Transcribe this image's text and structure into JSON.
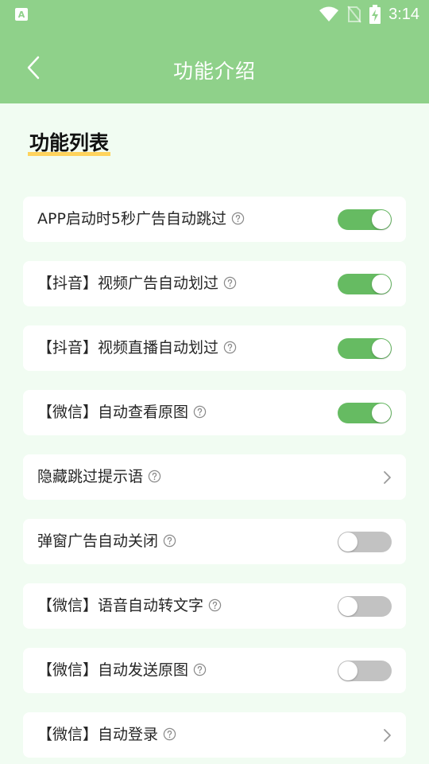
{
  "status_bar": {
    "app_icon_glyph": "A",
    "time": "3:14",
    "icons": [
      "wifi-icon",
      "no-sim-icon",
      "battery-charging-icon"
    ]
  },
  "header": {
    "title": "功能介绍",
    "back_icon": "chevron-left-icon",
    "background_color": "#8fd18a"
  },
  "section": {
    "title": "功能列表",
    "underline_color": "#ffd35c"
  },
  "colors": {
    "page_background": "#f1fcf2",
    "toggle_on": "#66bb62",
    "toggle_off": "#c2c2c2"
  },
  "features": [
    {
      "label": "APP启动时5秒广告自动跳过",
      "control": "toggle",
      "state": "on"
    },
    {
      "label": "【抖音】视频广告自动划过",
      "control": "toggle",
      "state": "on"
    },
    {
      "label": "【抖音】视频直播自动划过",
      "control": "toggle",
      "state": "on"
    },
    {
      "label": "【微信】自动查看原图",
      "control": "toggle",
      "state": "on"
    },
    {
      "label": "隐藏跳过提示语",
      "control": "chevron",
      "state": ""
    },
    {
      "label": "弹窗广告自动关闭",
      "control": "toggle",
      "state": "off"
    },
    {
      "label": "【微信】语音自动转文字",
      "control": "toggle",
      "state": "off"
    },
    {
      "label": "【微信】自动发送原图",
      "control": "toggle",
      "state": "off"
    },
    {
      "label": "【微信】自动登录",
      "control": "chevron",
      "state": ""
    }
  ]
}
